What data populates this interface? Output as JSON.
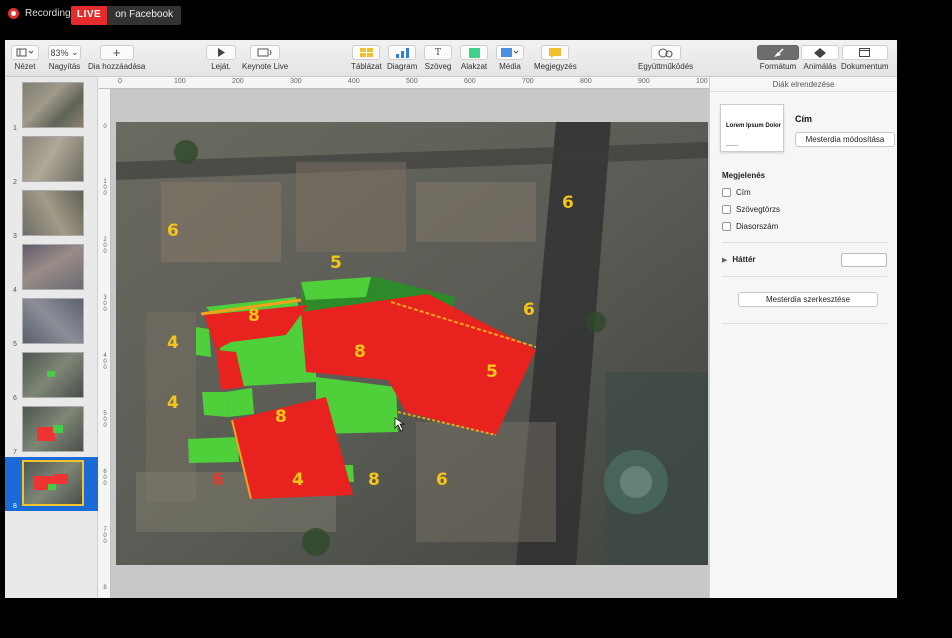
{
  "recording": {
    "label": "Recording",
    "live": "LIVE",
    "platform": "on Facebook"
  },
  "toolbar": {
    "view": {
      "label": "Nézet"
    },
    "zoom": {
      "label": "Nagyítás",
      "value": "83%"
    },
    "add_slide": {
      "label": "Dia hozzáadása"
    },
    "play": {
      "label": "Leját."
    },
    "keynote_live": {
      "label": "Keynote Live"
    },
    "table": {
      "label": "Táblázat"
    },
    "chart": {
      "label": "Diagram"
    },
    "text": {
      "label": "Szöveg"
    },
    "shape": {
      "label": "Alakzat"
    },
    "media": {
      "label": "Média"
    },
    "comment": {
      "label": "Megjegyzés"
    },
    "collaborate": {
      "label": "Együttműködés"
    },
    "format": {
      "label": "Formátum"
    },
    "animate": {
      "label": "Animálás"
    },
    "document": {
      "label": "Dokumentum"
    }
  },
  "navigator": {
    "slides": [
      {
        "number": "1"
      },
      {
        "number": "2"
      },
      {
        "number": "3"
      },
      {
        "number": "4"
      },
      {
        "number": "5"
      },
      {
        "number": "6"
      },
      {
        "number": "7"
      },
      {
        "number": "8",
        "selected": true
      }
    ]
  },
  "rulers": {
    "top": [
      "0",
      "100",
      "200",
      "300",
      "400",
      "500",
      "600",
      "700",
      "800",
      "900",
      "100"
    ],
    "left": [
      "0",
      "100",
      "200",
      "300",
      "400",
      "500",
      "600",
      "700",
      "8"
    ]
  },
  "slide": {
    "labels": [
      {
        "text": "6",
        "color": "#f5c518"
      },
      {
        "text": "5",
        "color": "#f5c518"
      },
      {
        "text": "6",
        "color": "#f5c518"
      },
      {
        "text": "6",
        "color": "#f5c518"
      },
      {
        "text": "8",
        "color": "#f5c518"
      },
      {
        "text": "8",
        "color": "#f5c518"
      },
      {
        "text": "5",
        "color": "#f5c518"
      },
      {
        "text": "4",
        "color": "#f5c518"
      },
      {
        "text": "4",
        "color": "#f5c518"
      },
      {
        "text": "8",
        "color": "#f5c518"
      },
      {
        "text": "4",
        "color": "#f5c518"
      },
      {
        "text": "8",
        "color": "#f5c518"
      },
      {
        "text": "6",
        "color": "#f5c518"
      },
      {
        "text": "6",
        "color": "#e63a2e"
      }
    ],
    "colors": {
      "red": "#e8231f",
      "green": "#4fcf3a",
      "dark_green": "#2e8a2a",
      "orange": "#f2a21a"
    }
  },
  "inspector": {
    "header": "Diák elrendezése",
    "master_thumb": {
      "title": "Lorem Ipsum Dolor",
      "subtitle": ""
    },
    "title": "Cím",
    "change_master": "Mesterdia módosítása",
    "appearance": "Megjelenés",
    "options": [
      {
        "label": "Cím",
        "checked": false
      },
      {
        "label": "Szövegtörzs",
        "checked": false
      },
      {
        "label": "Diasorszám",
        "checked": false
      }
    ],
    "background": "Háttér",
    "edit_master": "Mesterdia szerkesztése"
  }
}
